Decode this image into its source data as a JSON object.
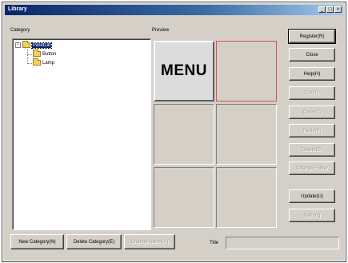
{
  "window": {
    "title": "Library"
  },
  "titlebar_buttons": [
    "_",
    "□",
    "×"
  ],
  "labels": {
    "category": "Category",
    "preview": "Preview",
    "title": "Title"
  },
  "tree": {
    "root": {
      "label": "ParetLib",
      "expander": "−"
    },
    "children": [
      "Button",
      "Lamp"
    ]
  },
  "preview": {
    "cells": [
      "MENU",
      "",
      "",
      "",
      "",
      ""
    ]
  },
  "right_buttons": [
    {
      "label": "Register(R)",
      "enabled": true
    },
    {
      "label": "Close",
      "enabled": true
    },
    {
      "label": "Help(H)",
      "enabled": true
    },
    {
      "label": "Cut(T)",
      "enabled": false
    },
    {
      "label": "Copy(C)",
      "enabled": false
    },
    {
      "label": "Paste(P)",
      "enabled": false
    },
    {
      "label": "Delete(D)",
      "enabled": false
    },
    {
      "label": "Change Folder",
      "enabled": false
    },
    {
      "label": "Update(U)",
      "enabled": true
    },
    {
      "label": "Naming",
      "enabled": false
    }
  ],
  "bottom_buttons": [
    {
      "label": "New Category(N)",
      "enabled": true
    },
    {
      "label": "Delete Category(E)",
      "enabled": true
    },
    {
      "label": "Change Name(A)",
      "enabled": false
    }
  ],
  "title_field": {
    "value": ""
  }
}
